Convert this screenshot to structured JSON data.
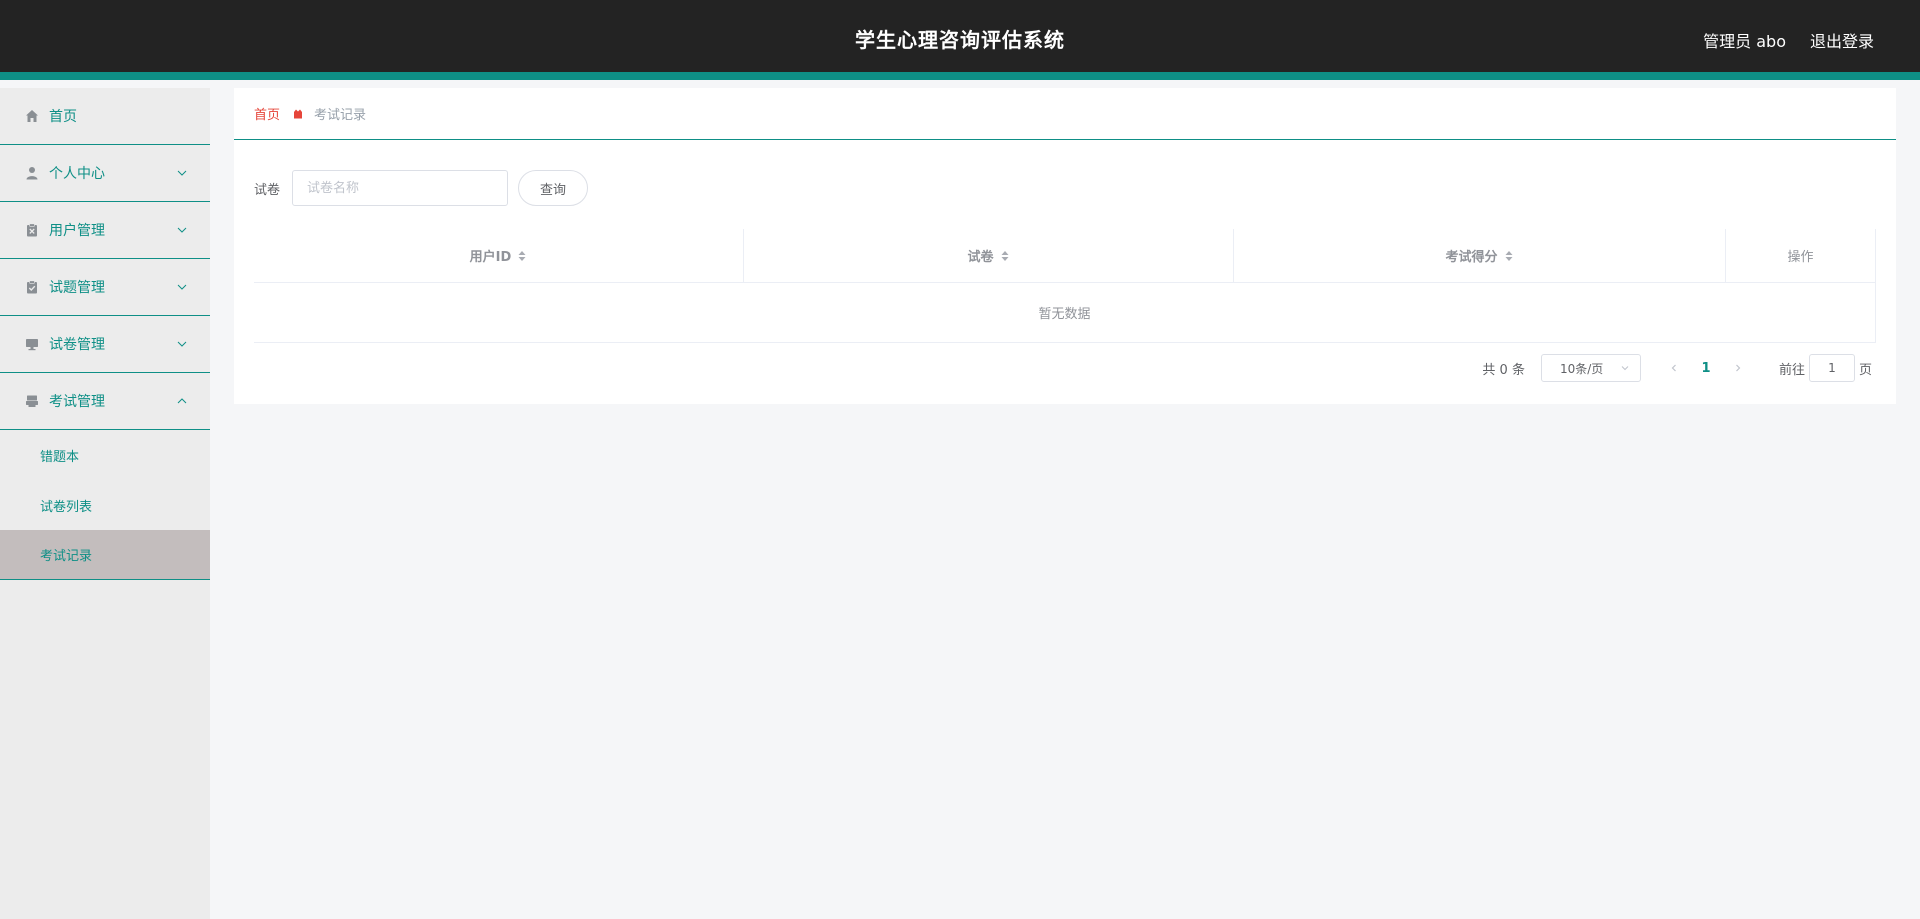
{
  "header": {
    "title": "学生心理咨询评估系统",
    "user_label": "管理员 abo",
    "logout_label": "退出登录"
  },
  "sidebar": {
    "items": [
      {
        "label": "首页",
        "icon": "home-icon"
      },
      {
        "label": "个人中心",
        "icon": "user-icon"
      },
      {
        "label": "用户管理",
        "icon": "clipboard-x-icon"
      },
      {
        "label": "试题管理",
        "icon": "clipboard-check-icon"
      },
      {
        "label": "试卷管理",
        "icon": "monitor-icon"
      },
      {
        "label": "考试管理",
        "icon": "printer-icon"
      }
    ],
    "submenu": [
      "错题本",
      "试卷列表",
      "考试记录"
    ]
  },
  "breadcrumb": {
    "home": "首页",
    "current": "考试记录"
  },
  "search": {
    "label": "试卷",
    "placeholder": "试卷名称",
    "button": "查询"
  },
  "table": {
    "columns": [
      "用户ID",
      "试卷",
      "考试得分",
      "操作"
    ],
    "empty_text": "暂无数据"
  },
  "pagination": {
    "total_text": "共 0 条",
    "page_size": "10条/页",
    "current_page": "1",
    "goto_label": "前往",
    "goto_value": "1",
    "page_suffix": "页"
  },
  "colors": {
    "accent": "#0e8f86",
    "header_bg": "#232323",
    "breadcrumb_home": "#e6453a"
  }
}
